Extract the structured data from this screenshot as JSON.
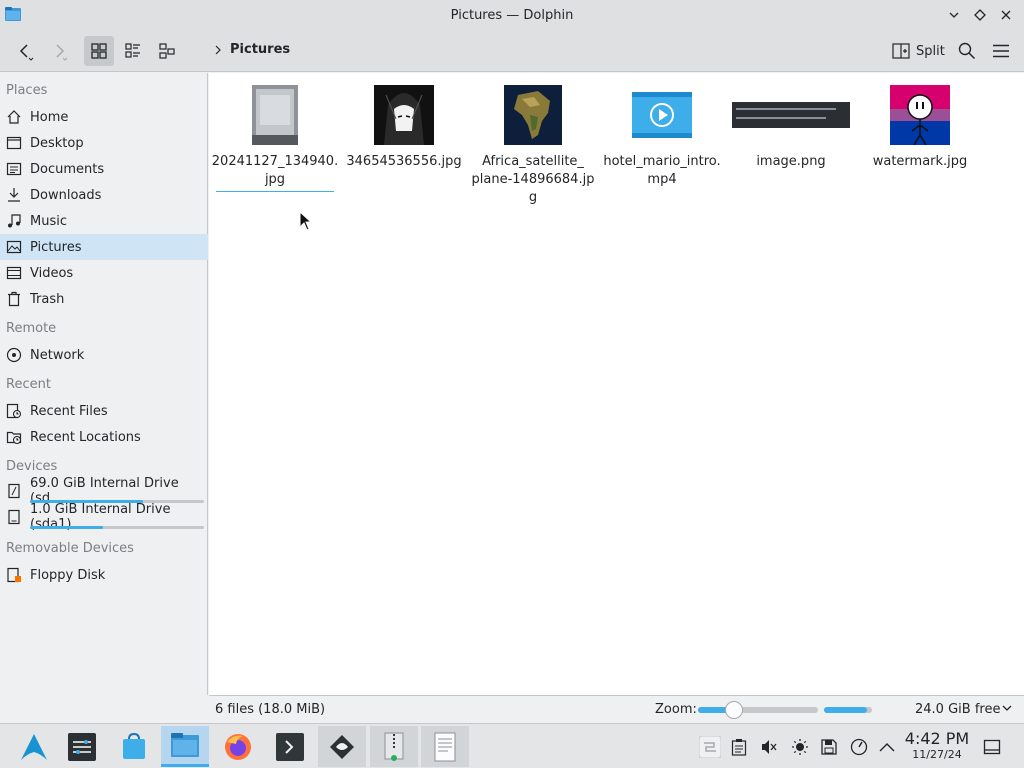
{
  "window": {
    "title": "Pictures — Dolphin"
  },
  "toolbar": {
    "breadcrumb": "Pictures",
    "split_label": "Split"
  },
  "sidebar": {
    "places_header": "Places",
    "places": [
      {
        "label": "Home",
        "icon": "home-icon"
      },
      {
        "label": "Desktop",
        "icon": "desktop-icon"
      },
      {
        "label": "Documents",
        "icon": "documents-icon"
      },
      {
        "label": "Downloads",
        "icon": "downloads-icon"
      },
      {
        "label": "Music",
        "icon": "music-icon"
      },
      {
        "label": "Pictures",
        "icon": "pictures-icon",
        "selected": true
      },
      {
        "label": "Videos",
        "icon": "videos-icon"
      },
      {
        "label": "Trash",
        "icon": "trash-icon"
      }
    ],
    "remote_header": "Remote",
    "remote": [
      {
        "label": "Network",
        "icon": "network-icon"
      }
    ],
    "recent_header": "Recent",
    "recent": [
      {
        "label": "Recent Files",
        "icon": "recent-files-icon"
      },
      {
        "label": "Recent Locations",
        "icon": "recent-locations-icon"
      }
    ],
    "devices_header": "Devices",
    "devices": [
      {
        "label": "69.0 GiB Internal Drive (sd…",
        "usage": 0.65
      },
      {
        "label": "1.0 GiB Internal Drive (sda1)",
        "usage": 0.42
      }
    ],
    "removable_header": "Removable Devices",
    "removable": [
      {
        "label": "Floppy Disk",
        "icon": "floppy-icon"
      }
    ]
  },
  "files": [
    {
      "line1": "20241127_134940.",
      "line2": "jpg",
      "thumb": "photo-thumbnail"
    },
    {
      "line1": "34654536556.jpg",
      "line2": "",
      "thumb": "manga-thumbnail"
    },
    {
      "line1": "Africa_satellite_",
      "line2": "plane-14896684.jpg",
      "thumb": "africa-thumbnail"
    },
    {
      "line1": "hotel_mario_intro.",
      "line2": "mp4",
      "thumb": "video-file-icon"
    },
    {
      "line1": "image.png",
      "line2": "",
      "thumb": "screenshot-thumbnail"
    },
    {
      "line1": "watermark.jpg",
      "line2": "",
      "thumb": "watermark-thumbnail"
    }
  ],
  "status": {
    "count": "6 files (18.0 MiB)",
    "zoom_label": "Zoom:",
    "zoom_level": 0.3,
    "free_space": "24.0 GiB free",
    "free_fraction": 0.9
  },
  "taskbar": {
    "time": "4:42 PM",
    "date": "11/27/24"
  },
  "colors": {
    "accent": "#3daee9",
    "selection": "#cfe4f5"
  }
}
